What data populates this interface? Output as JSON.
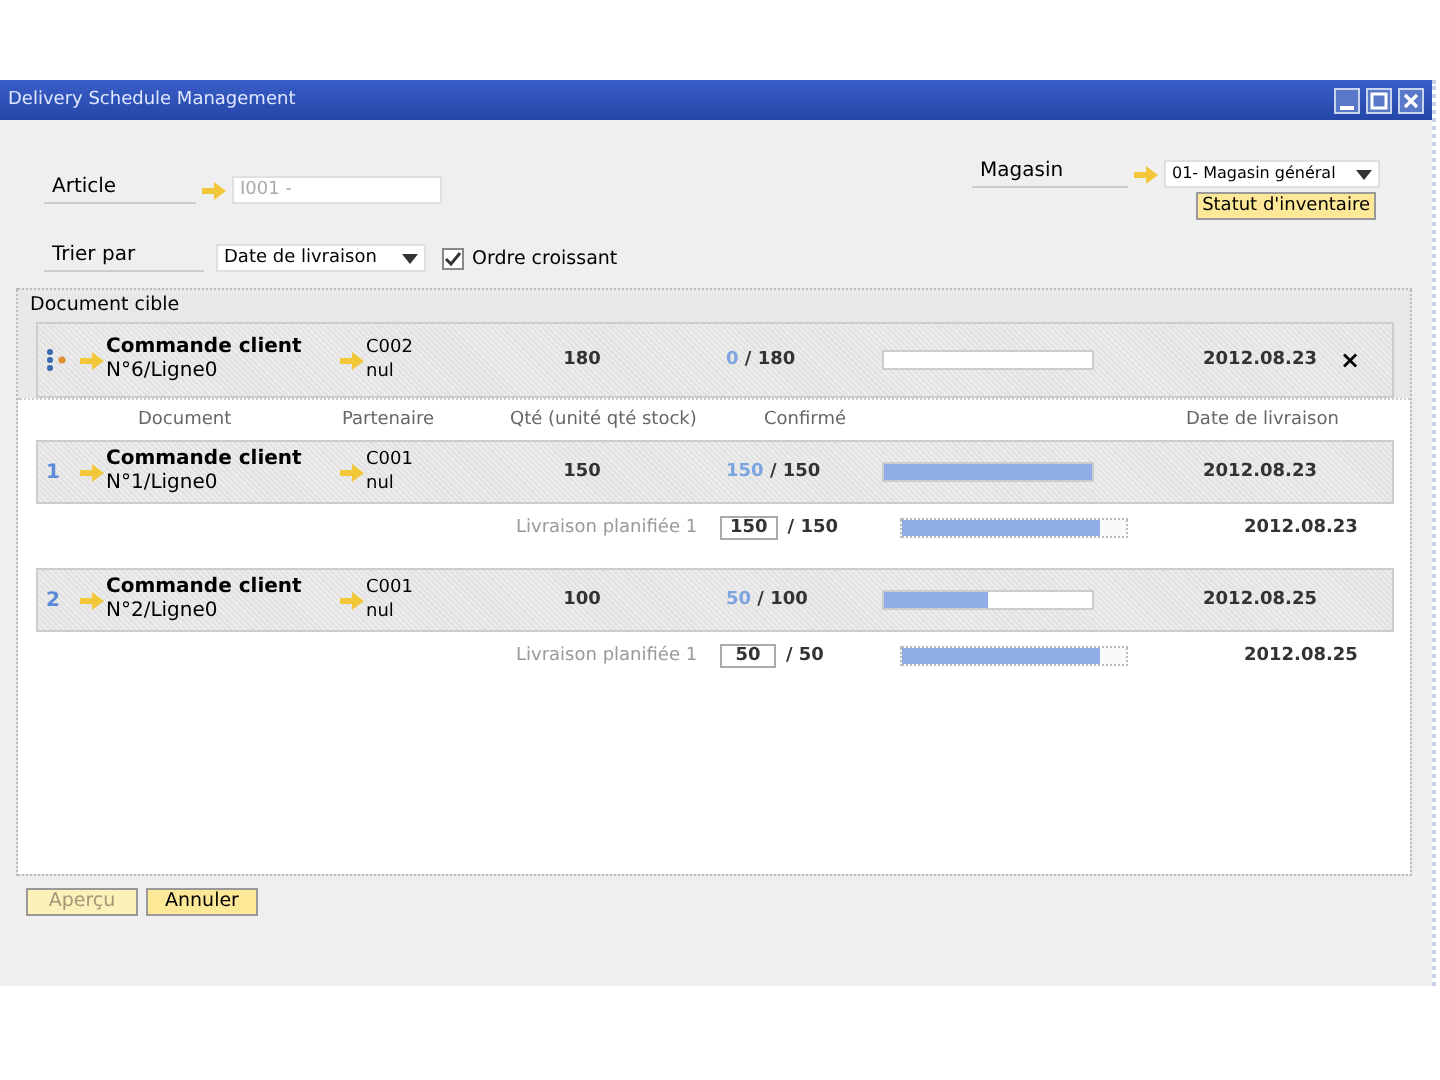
{
  "window": {
    "title": "Delivery Schedule Management"
  },
  "article": {
    "label": "Article",
    "value": "I001 -"
  },
  "warehouse": {
    "label": "Magasin",
    "value": "01- Magasin général",
    "button": "Statut d'inventaire"
  },
  "sort": {
    "label": "Trier par",
    "value": "Date de livraison",
    "checkbox_label": "Ordre croissant",
    "checked": true
  },
  "target": {
    "title": "Document cible",
    "document": "Commande client",
    "line": "N°6/Ligne0",
    "partner_code": "C002",
    "partner_name": "nul",
    "qty": "180",
    "confirmed": "0",
    "total": "/ 180",
    "level": 0,
    "date": "2012.08.23",
    "close": "×"
  },
  "columns": [
    "Document",
    "Partenaire",
    "Qté (unité qté stock)",
    "Confirmé",
    "Date de livraison"
  ],
  "rows": [
    {
      "index": "1",
      "document": "Commande client",
      "line": "N°1/Ligne0",
      "partner_code": "C001",
      "partner_name": "nul",
      "qty": "150",
      "confirmed": "150",
      "total": "/ 150",
      "level": 1,
      "date": "2012.08.23",
      "plan": {
        "label": "Livraison planifiée 1",
        "value": "150",
        "total": "/ 150",
        "level": 0.88,
        "date": "2012.08.23"
      }
    },
    {
      "index": "2",
      "document": "Commande client",
      "line": "N°2/Ligne0",
      "partner_code": "C001",
      "partner_name": "nul",
      "qty": "100",
      "confirmed": "50",
      "total": "/ 100",
      "level": 0.5,
      "date": "2012.08.25",
      "plan": {
        "label": "Livraison planifiée 1",
        "value": "50",
        "total": "/ 50",
        "level": 0.88,
        "date": "2012.08.25"
      }
    }
  ],
  "buttons": [
    {
      "label": "Aperçu",
      "disabled": true
    },
    {
      "label": "Annuler",
      "disabled": false
    }
  ]
}
